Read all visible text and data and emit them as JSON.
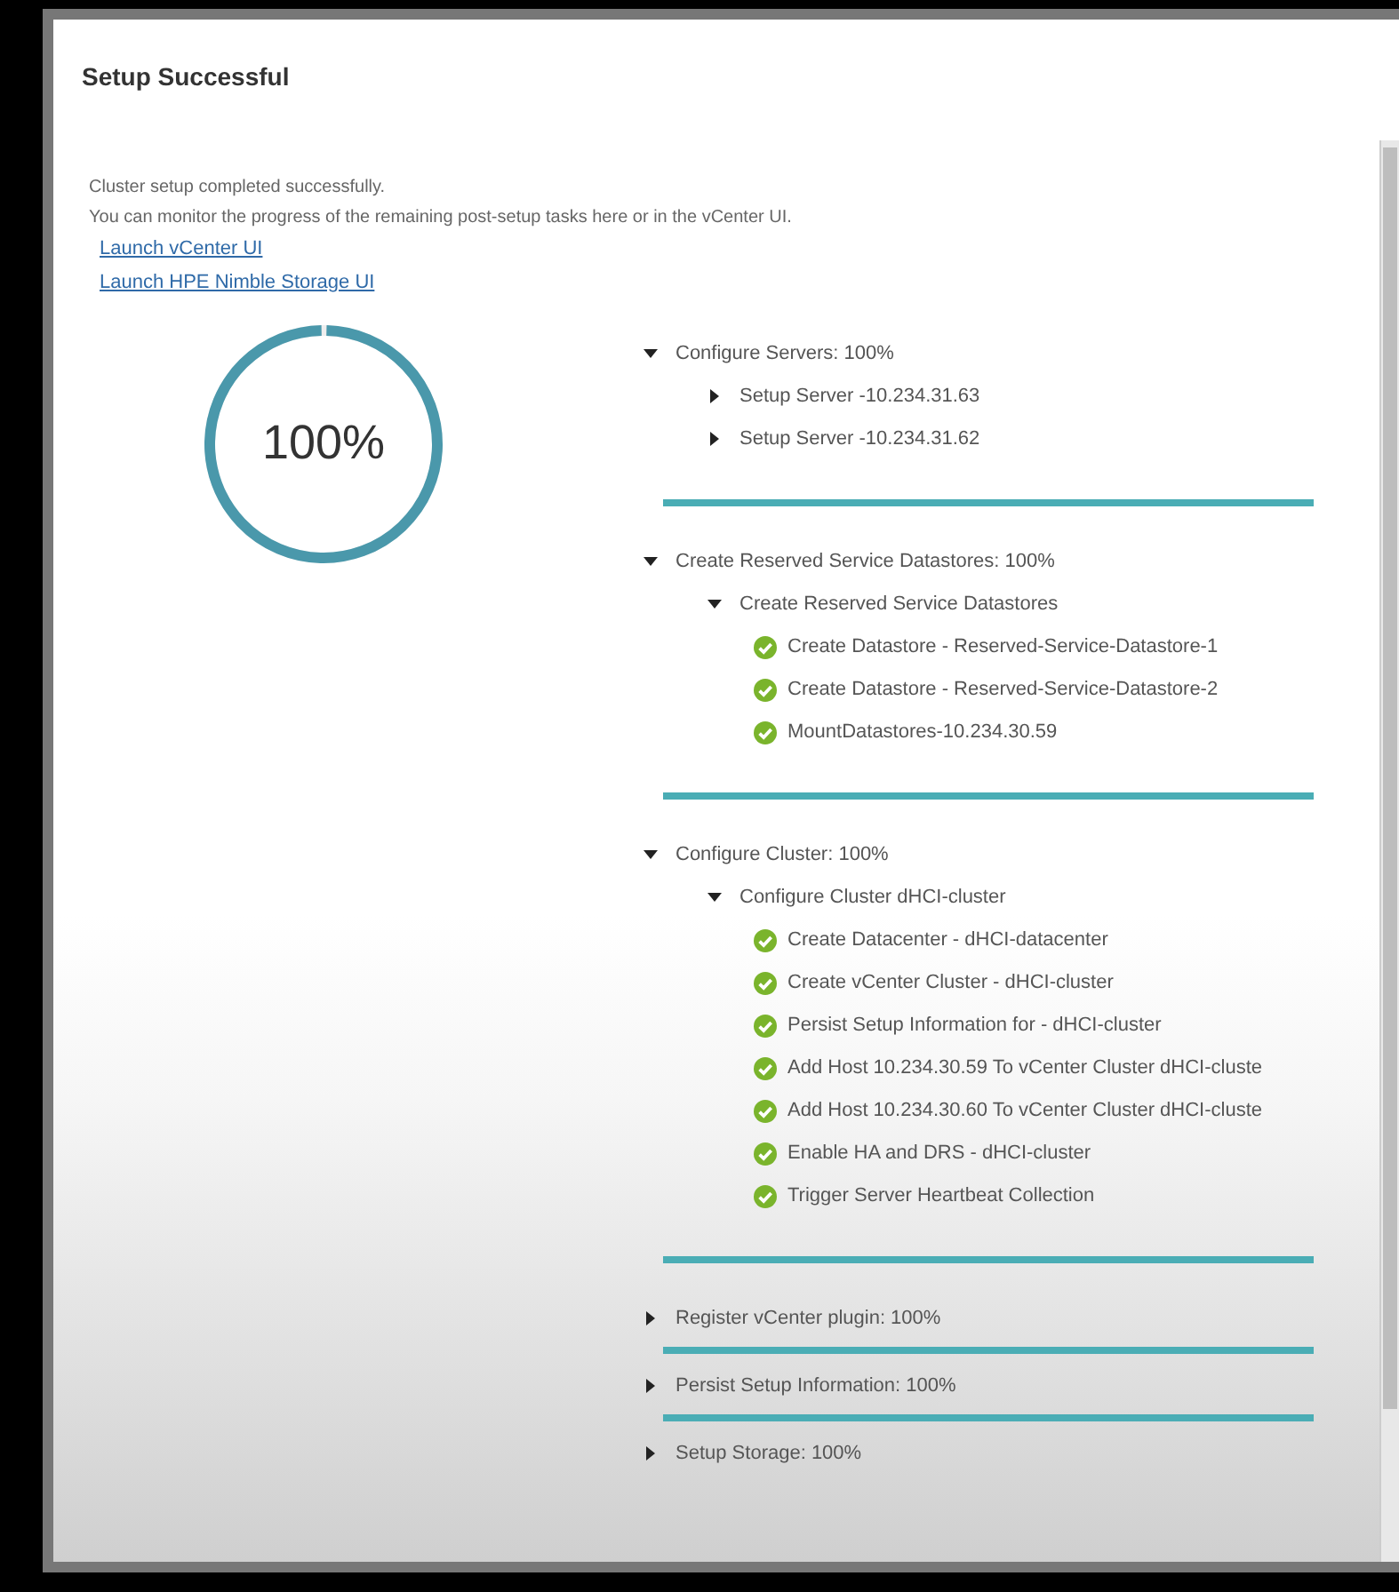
{
  "dialog": {
    "title": "Setup Successful"
  },
  "messages": [
    "Cluster setup completed successfully.",
    "You can monitor the progress of the remaining post-setup tasks here or in the vCenter UI."
  ],
  "links": [
    "Launch vCenter UI",
    "Launch HPE Nimble Storage UI"
  ],
  "overall_progress": {
    "level": 1,
    "reading": "100%"
  },
  "sections": [
    {
      "label": "Configure Servers: 100%",
      "expanded": true,
      "level": 1,
      "children": [
        {
          "label": "Setup Server -10.234.31.63",
          "kind": "group",
          "expanded": false
        },
        {
          "label": "Setup Server -10.234.31.62",
          "kind": "group",
          "expanded": false
        }
      ]
    },
    {
      "label": "Create Reserved Service Datastores: 100%",
      "expanded": true,
      "level": 1,
      "children": [
        {
          "label": "Create Reserved Service Datastores",
          "kind": "group",
          "expanded": true,
          "children": [
            {
              "label": "Create Datastore - Reserved-Service-Datastore-1",
              "kind": "task",
              "done": true
            },
            {
              "label": "Create Datastore - Reserved-Service-Datastore-2",
              "kind": "task",
              "done": true
            },
            {
              "label": "MountDatastores-10.234.30.59",
              "kind": "task",
              "done": true
            }
          ]
        }
      ]
    },
    {
      "label": "Configure Cluster: 100%",
      "expanded": true,
      "level": 1,
      "children": [
        {
          "label": "Configure Cluster dHCI-cluster",
          "kind": "group",
          "expanded": true,
          "children": [
            {
              "label": "Create Datacenter - dHCI-datacenter",
              "kind": "task",
              "done": true
            },
            {
              "label": "Create vCenter Cluster - dHCI-cluster",
              "kind": "task",
              "done": true
            },
            {
              "label": "Persist Setup Information for - dHCI-cluster",
              "kind": "task",
              "done": true
            },
            {
              "label": "Add Host 10.234.30.59 To vCenter Cluster dHCI-cluste",
              "kind": "task",
              "done": true
            },
            {
              "label": "Add Host 10.234.30.60 To vCenter Cluster dHCI-cluste",
              "kind": "task",
              "done": true
            },
            {
              "label": "Enable HA and DRS - dHCI-cluster",
              "kind": "task",
              "done": true
            },
            {
              "label": "Trigger Server Heartbeat Collection",
              "kind": "task",
              "done": true
            }
          ]
        }
      ]
    },
    {
      "label": "Register vCenter plugin: 100%",
      "expanded": false,
      "level": 1
    },
    {
      "label": "Persist Setup Information: 100%",
      "expanded": false,
      "level": 1
    },
    {
      "label": "Setup Storage: 100%",
      "expanded": false
    }
  ]
}
